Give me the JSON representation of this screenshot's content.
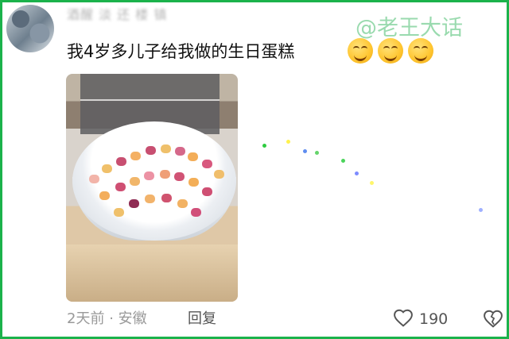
{
  "comment": {
    "username_obscured": "酒醒 淡 还 楼 镇",
    "text": "我4岁多儿子给我做的生日蛋糕",
    "emojis": [
      "smiling-face-icon",
      "smiling-face-icon",
      "smiling-face-icon"
    ],
    "meta": {
      "time": "2天前",
      "separator": "·",
      "location": "安徽",
      "reply_label": "回复"
    },
    "likes": "190"
  },
  "watermark": "@老王大话",
  "colors": {
    "border": "#1bb24b",
    "watermark": "#8fd7a6"
  }
}
